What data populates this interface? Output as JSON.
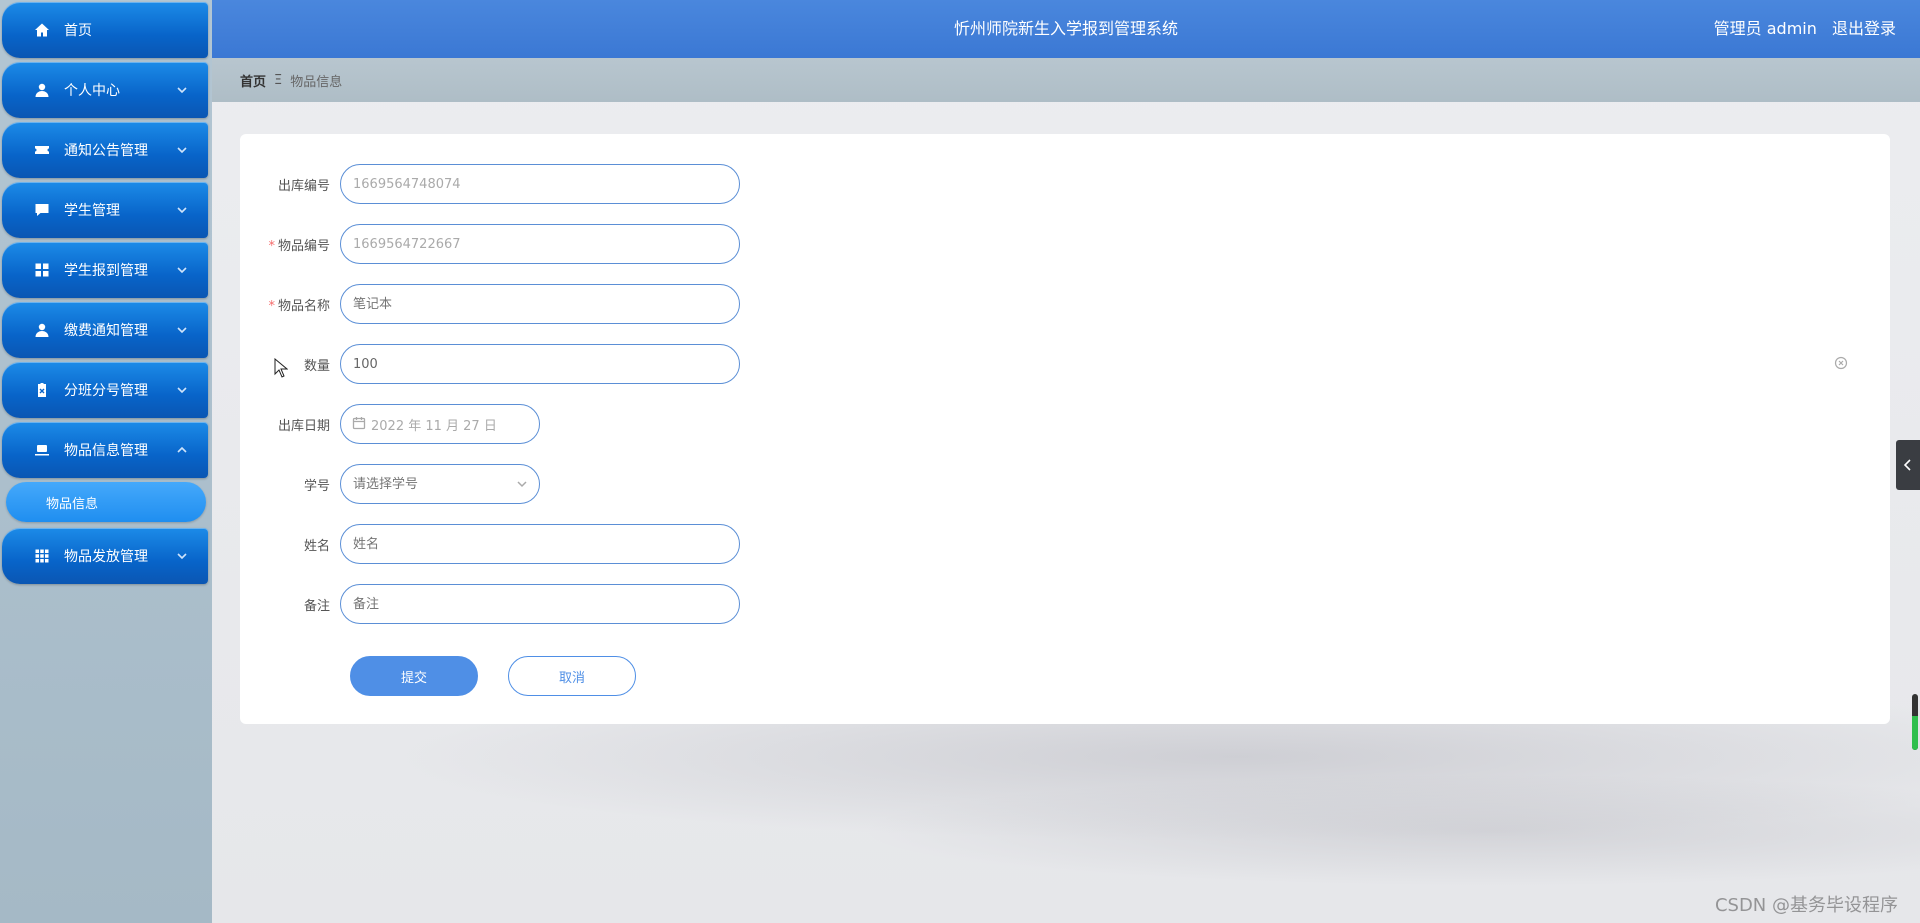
{
  "header": {
    "title": "忻州师院新生入学报到管理系统",
    "user_label": "管理员 admin",
    "logout_label": "退出登录"
  },
  "sidebar": {
    "items": [
      {
        "label": "首页",
        "icon": "home-icon",
        "expandable": false
      },
      {
        "label": "个人中心",
        "icon": "user-icon",
        "expandable": true
      },
      {
        "label": "通知公告管理",
        "icon": "ticket-icon",
        "expandable": true
      },
      {
        "label": "学生管理",
        "icon": "chat-icon",
        "expandable": true
      },
      {
        "label": "学生报到管理",
        "icon": "grid-icon",
        "expandable": true
      },
      {
        "label": "缴费通知管理",
        "icon": "user-icon",
        "expandable": true
      },
      {
        "label": "分班分号管理",
        "icon": "clipboard-icon",
        "expandable": true
      },
      {
        "label": "物品信息管理",
        "icon": "laptop-icon",
        "expandable": true,
        "expanded": true
      },
      {
        "label": "物品发放管理",
        "icon": "apps-icon",
        "expandable": true
      }
    ],
    "submenu_active": "物品信息"
  },
  "breadcrumb": {
    "home": "首页",
    "separator": "Ξ",
    "current": "物品信息"
  },
  "form": {
    "outbound_no": {
      "label": "出库编号",
      "value": "1669564748074",
      "required": false
    },
    "item_no": {
      "label": "物品编号",
      "value": "1669564722667",
      "required": true
    },
    "item_name": {
      "label": "物品名称",
      "placeholder": "笔记本",
      "required": true
    },
    "quantity": {
      "label": "数量",
      "value": "100",
      "required": false
    },
    "outbound_date": {
      "label": "出库日期",
      "value": "2022 年 11 月 27 日",
      "required": false
    },
    "student_id": {
      "label": "学号",
      "placeholder": "请选择学号",
      "required": false
    },
    "name": {
      "label": "姓名",
      "placeholder": "姓名",
      "required": false
    },
    "remark": {
      "label": "备注",
      "placeholder": "备注",
      "required": false
    },
    "required_mark": "*",
    "submit_label": "提交",
    "cancel_label": "取消"
  },
  "watermark": "CSDN @基务毕设程序"
}
